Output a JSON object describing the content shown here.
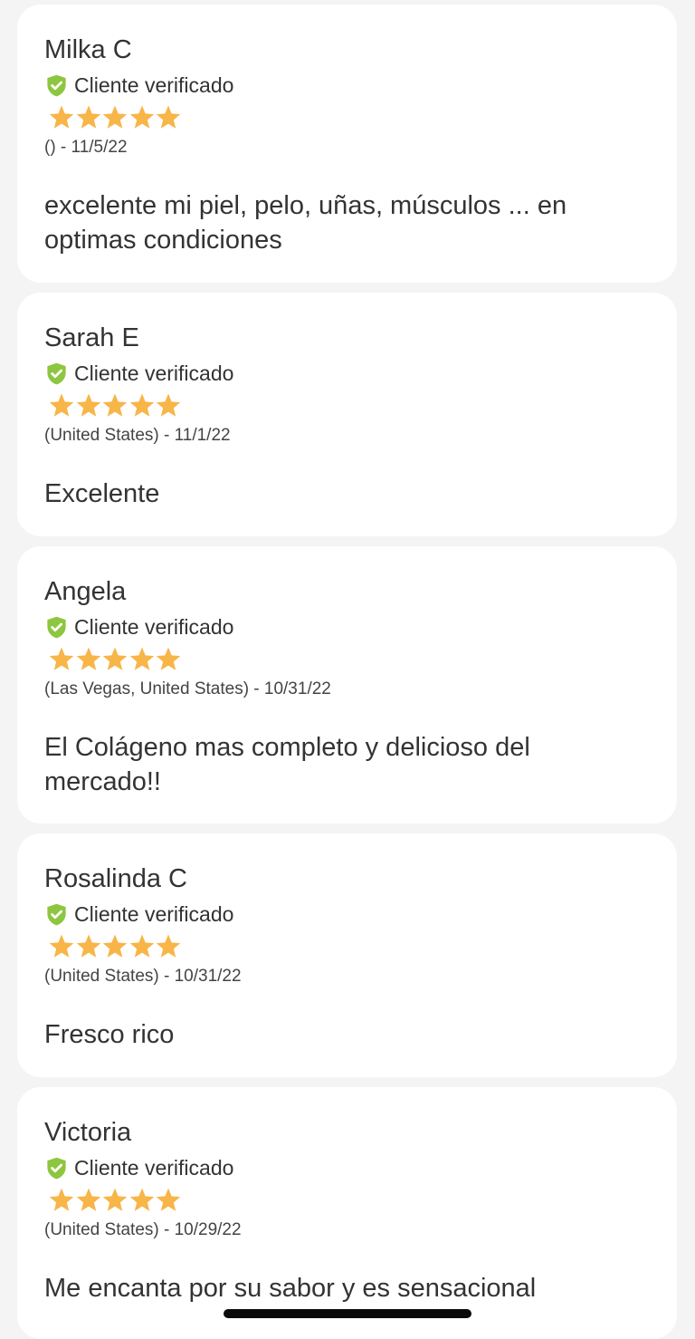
{
  "colors": {
    "page_background": "#f4f4f4",
    "card_background": "#ffffff",
    "star": "#f8b548",
    "verified_shield": "#8dc63f",
    "text": "#333333"
  },
  "icons": {
    "verified": "shield-check-icon",
    "rating": "star-icon"
  },
  "reviews": [
    {
      "author": "Milka C",
      "verified_label": "Cliente verificado",
      "rating": 5,
      "rating_max": 5,
      "meta": "() - 11/5/22",
      "body": "excelente mi piel, pelo, uñas, músculos ... en optimas condiciones"
    },
    {
      "author": "Sarah E",
      "verified_label": "Cliente verificado",
      "rating": 5,
      "rating_max": 5,
      "meta": "(United States) - 11/1/22",
      "body": "Excelente"
    },
    {
      "author": "Angela",
      "verified_label": "Cliente verificado",
      "rating": 5,
      "rating_max": 5,
      "meta": "(Las Vegas, United States) - 10/31/22",
      "body": "El Colágeno mas completo y delicioso del mercado!!"
    },
    {
      "author": "Rosalinda C",
      "verified_label": "Cliente verificado",
      "rating": 5,
      "rating_max": 5,
      "meta": "(United States) - 10/31/22",
      "body": "Fresco rico"
    },
    {
      "author": "Victoria",
      "verified_label": "Cliente verificado",
      "rating": 5,
      "rating_max": 5,
      "meta": "(United States) - 10/29/22",
      "body": "Me encanta por su sabor y es sensacional"
    }
  ]
}
